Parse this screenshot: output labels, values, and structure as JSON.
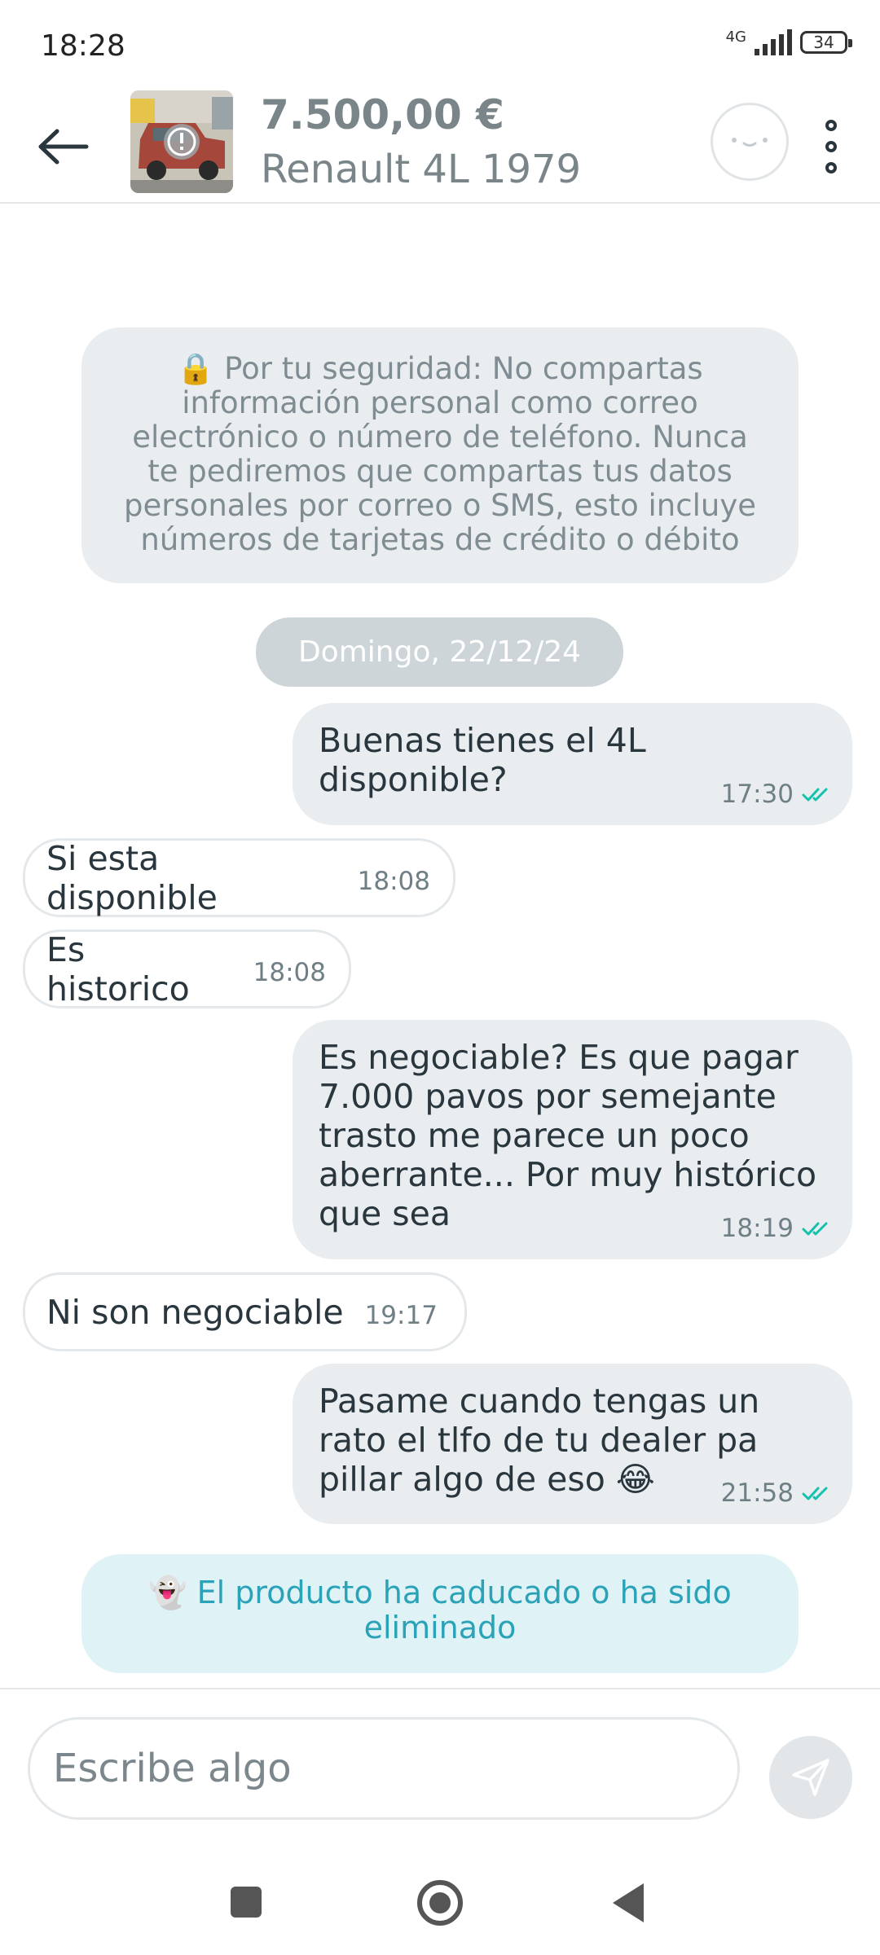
{
  "status_bar": {
    "time": "18:28",
    "network": "4G",
    "battery": "34"
  },
  "header": {
    "price": "7.500,00 €",
    "title": "Renault 4L 1979",
    "back_icon": "arrow-left-icon",
    "more_icon": "more-vertical-icon"
  },
  "security_notice": "🔒 Por tu seguridad: No compartas información personal como correo electrónico o número de teléfono. Nunca te pediremos que compartas tus datos personales por correo o SMS, esto incluye números de tarjetas de crédito o débito",
  "date_separator": "Domingo, 22/12/24",
  "messages": [
    {
      "direction": "outgoing",
      "text": "Buenas tienes el 4L\ndisponible?",
      "time": "17:30",
      "read": true
    },
    {
      "direction": "incoming",
      "text": "Si esta disponible",
      "time": "18:08"
    },
    {
      "direction": "incoming",
      "text": "Es historico",
      "time": "18:08"
    },
    {
      "direction": "outgoing",
      "text": "Es negociable? Es que pagar\n7.000 pavos por semejante\ntrasto me parece un poco\naberrante... Por muy histórico\nque sea",
      "time": "18:19",
      "read": true
    },
    {
      "direction": "incoming",
      "text": "Ni  son negociable",
      "time": "19:17"
    },
    {
      "direction": "outgoing",
      "text": "Pasame cuando tengas un\nrato el tlfo de tu dealer pa\npillar algo de eso 😂",
      "time": "21:58",
      "read": true
    }
  ],
  "product_status": "👻 El producto ha caducado o ha sido eliminado",
  "composer": {
    "placeholder": "Escribe algo",
    "send_icon": "send-icon"
  },
  "colors": {
    "read_ticks": "#13c1ac",
    "expired_text": "#2aa2b8",
    "bubble_out": "#e9edef"
  }
}
